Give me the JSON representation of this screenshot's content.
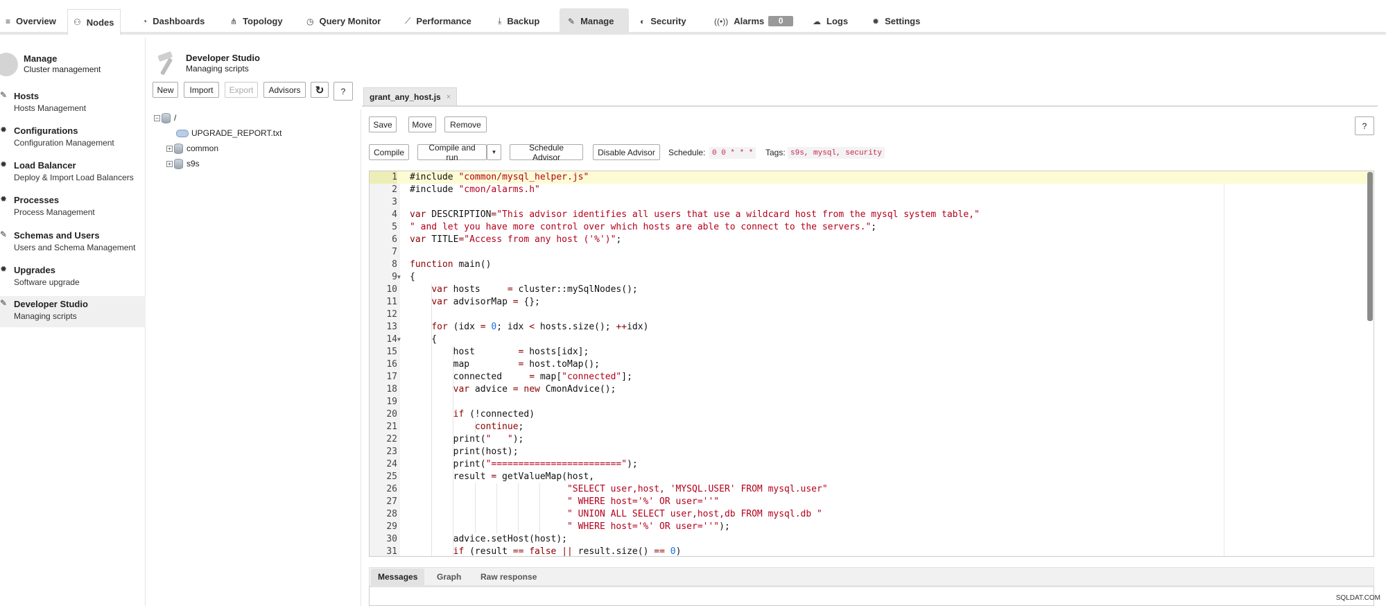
{
  "nav": {
    "tabs": [
      {
        "label": "Overview",
        "icon": "list-icon"
      },
      {
        "label": "Nodes",
        "icon": "nodes-icon"
      },
      {
        "label": "Dashboards",
        "icon": "dashboard-icon"
      },
      {
        "label": "Topology",
        "icon": "topology-icon"
      },
      {
        "label": "Query Monitor",
        "icon": "clock-icon"
      },
      {
        "label": "Performance",
        "icon": "chart-icon"
      },
      {
        "label": "Backup",
        "icon": "download-icon"
      },
      {
        "label": "Manage",
        "icon": "wrench-icon"
      },
      {
        "label": "Security",
        "icon": "shield-icon"
      },
      {
        "label": "Alarms",
        "icon": "broadcast-icon"
      },
      {
        "label": "Logs",
        "icon": "logs-icon"
      },
      {
        "label": "Settings",
        "icon": "gear-icon"
      }
    ],
    "alarms_count": "0"
  },
  "sidebar": {
    "title": "Manage",
    "subtitle": "Cluster management",
    "items": [
      {
        "label": "Hosts",
        "sub": "Hosts Management",
        "icon": "wrench-icon"
      },
      {
        "label": "Configurations",
        "sub": "Configuration Management",
        "icon": "gear-icon"
      },
      {
        "label": "Load Balancer",
        "sub": "Deploy & Import Load Balancers",
        "icon": "gear-icon"
      },
      {
        "label": "Processes",
        "sub": "Process Management",
        "icon": "gear-icon"
      },
      {
        "label": "Schemas and Users",
        "sub": "Users and Schema Management",
        "icon": "wrench-icon"
      },
      {
        "label": "Upgrades",
        "sub": "Software upgrade",
        "icon": "gear-icon"
      },
      {
        "label": "Developer Studio",
        "sub": "Managing scripts",
        "icon": "wrench-icon"
      }
    ]
  },
  "studio": {
    "title": "Developer Studio",
    "subtitle": "Managing scripts",
    "buttons": {
      "new": "New",
      "import": "Import",
      "export": "Export",
      "advisors": "Advisors",
      "refresh": "↻",
      "help": "?"
    },
    "tree": {
      "root": "/",
      "file": "UPGRADE_REPORT.txt",
      "folder1": "common",
      "folder2": "s9s"
    }
  },
  "editor": {
    "file_tab": "grant_any_host.js",
    "close": "×",
    "buttons": {
      "save": "Save",
      "move": "Move",
      "remove": "Remove",
      "help": "?",
      "compile": "Compile",
      "compile_run": "Compile and run",
      "caret": "▾",
      "schedule_advisor": "Schedule Advisor",
      "disable_advisor": "Disable Advisor"
    },
    "schedule_label": "Schedule:",
    "schedule_value": "0 0 * * *",
    "tags_label": "Tags:",
    "tags_value": "s9s, mysql, security"
  },
  "code": [
    "#include \"common/mysql_helper.js\"",
    "#include \"cmon/alarms.h\"",
    "",
    "var DESCRIPTION=\"This advisor identifies all users that use a wildcard host from the mysql system table,\"",
    "\" and let you have more control over which hosts are able to connect to the servers.\";",
    "var TITLE=\"Access from any host ('%')\";",
    "",
    "function main()",
    "{",
    "    var hosts     = cluster::mySqlNodes();",
    "    var advisorMap = {};",
    "",
    "    for (idx = 0; idx < hosts.size(); ++idx)",
    "    {",
    "        host        = hosts[idx];",
    "        map         = host.toMap();",
    "        connected     = map[\"connected\"];",
    "        var advice = new CmonAdvice();",
    "",
    "        if (!connected)",
    "            continue;",
    "        print(\"   \");",
    "        print(host);",
    "        print(\"========================\");",
    "        result = getValueMap(host,",
    "                             \"SELECT user,host, 'MYSQL.USER' FROM mysql.user\"",
    "                             \" WHERE host='%' OR user=''\"",
    "                             \" UNION ALL SELECT user,host,db FROM mysql.db \"",
    "                             \" WHERE host='%' OR user=''\");",
    "        advice.setHost(host);",
    "        if (result == false || result.size() == 0)"
  ],
  "messages": {
    "tabs": [
      "Messages",
      "Graph",
      "Raw response"
    ]
  },
  "watermark": "SQLDAT.COM"
}
